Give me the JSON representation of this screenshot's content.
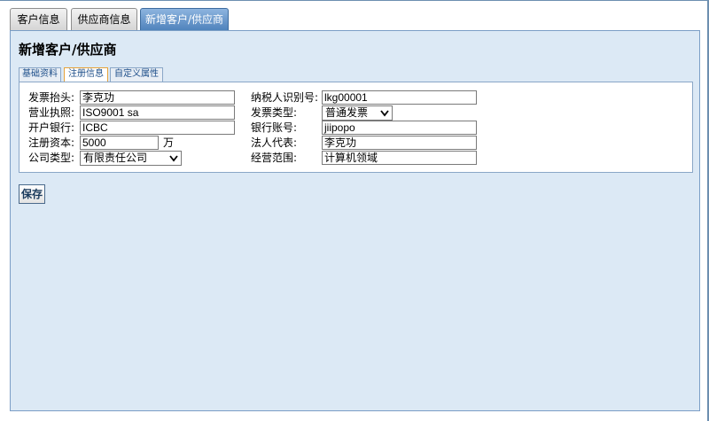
{
  "top_tabs": [
    {
      "label": "客户信息"
    },
    {
      "label": "供应商信息"
    },
    {
      "label": "新增客户/供应商"
    }
  ],
  "page_title": "新增客户/供应商",
  "sub_tabs": [
    {
      "label": "基础资料"
    },
    {
      "label": "注册信息"
    },
    {
      "label": "自定义属性"
    }
  ],
  "form": {
    "invoice_title": {
      "label": "发票抬头:",
      "value": "李克功"
    },
    "business_license": {
      "label": "营业执照:",
      "value": "ISO9001 sa"
    },
    "bank": {
      "label": "开户银行:",
      "value": "ICBC"
    },
    "registered_capital": {
      "label": "注册资本:",
      "value": "5000",
      "unit": "万"
    },
    "company_type": {
      "label": "公司类型:",
      "value": "有限责任公司"
    },
    "taxpayer_id": {
      "label": "纳税人识别号:",
      "value": "lkg00001"
    },
    "invoice_type": {
      "label": "发票类型:",
      "value": "普通发票"
    },
    "bank_account": {
      "label": "银行账号:",
      "value": "jiipopo"
    },
    "legal_rep": {
      "label": "法人代表:",
      "value": "李克功"
    },
    "business_scope": {
      "label": "经营范围:",
      "value": "计算机领域"
    }
  },
  "save_label": "保存",
  "colors": {
    "panel_bg": "#dce9f5",
    "active_tab": "#4a7fb9",
    "border": "#7b9ec6"
  }
}
